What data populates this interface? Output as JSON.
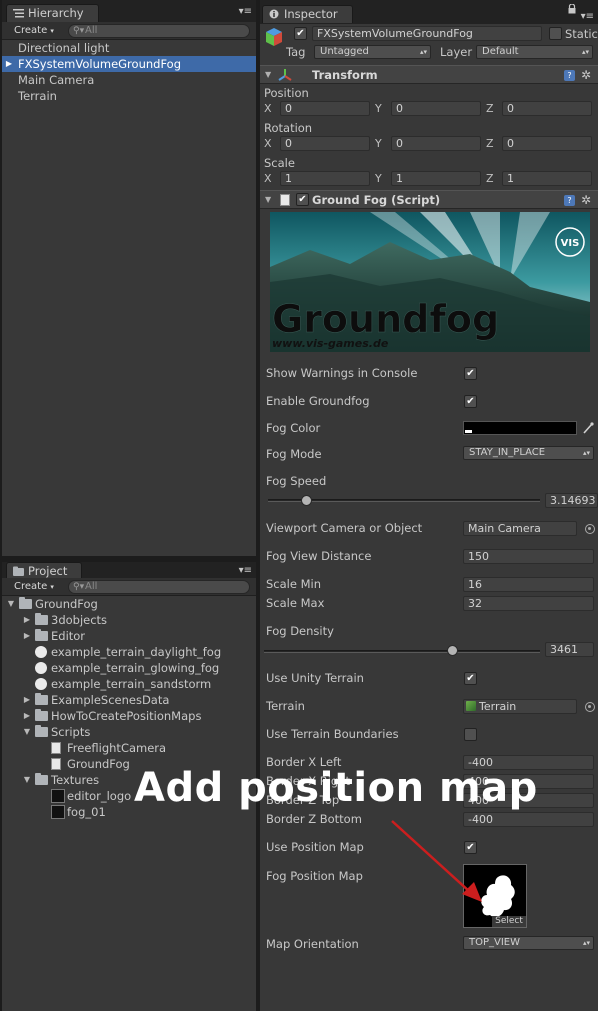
{
  "hierarchy": {
    "tab_label": "Hierarchy",
    "create_label": "Create",
    "search_placeholder": "All",
    "items": [
      {
        "label": "Directional light",
        "selected": false
      },
      {
        "label": "FXSystemVolumeGroundFog",
        "selected": true
      },
      {
        "label": "Main Camera",
        "selected": false
      },
      {
        "label": "Terrain",
        "selected": false
      }
    ]
  },
  "project": {
    "tab_label": "Project",
    "create_label": "Create",
    "search_placeholder": "All",
    "items": [
      {
        "label": "GroundFog",
        "icon": "folder-icon",
        "arrow": "expanded",
        "indent": 0
      },
      {
        "label": "3dobjects",
        "icon": "folder-icon",
        "arrow": "collapsed",
        "indent": 1
      },
      {
        "label": "Editor",
        "icon": "folder-icon",
        "arrow": "collapsed",
        "indent": 1
      },
      {
        "label": "example_terrain_daylight_fog",
        "icon": "unity-scene-icon",
        "arrow": "none",
        "indent": 1
      },
      {
        "label": "example_terrain_glowing_fog",
        "icon": "unity-scene-icon",
        "arrow": "none",
        "indent": 1
      },
      {
        "label": "example_terrain_sandstorm",
        "icon": "unity-scene-icon",
        "arrow": "none",
        "indent": 1
      },
      {
        "label": "ExampleScenesData",
        "icon": "folder-icon",
        "arrow": "collapsed",
        "indent": 1
      },
      {
        "label": "HowToCreatePositionMaps",
        "icon": "folder-icon",
        "arrow": "collapsed",
        "indent": 1
      },
      {
        "label": "Scripts",
        "icon": "folder-icon",
        "arrow": "expanded",
        "indent": 1
      },
      {
        "label": "FreeflightCamera",
        "icon": "script-file-icon",
        "arrow": "none",
        "indent": 2
      },
      {
        "label": "GroundFog",
        "icon": "script-file-icon",
        "arrow": "none",
        "indent": 2
      },
      {
        "label": "Textures",
        "icon": "folder-icon",
        "arrow": "expanded",
        "indent": 1
      },
      {
        "label": "editor_logo",
        "icon": "texture-icon",
        "arrow": "none",
        "indent": 2
      },
      {
        "label": "fog_01",
        "icon": "texture-icon",
        "arrow": "none",
        "indent": 2
      }
    ]
  },
  "inspector": {
    "tab_label": "Inspector",
    "object_name": "FXSystemVolumeGroundFog",
    "static_label": "Static",
    "tag_label": "Tag",
    "tag_value": "Untagged",
    "layer_label": "Layer",
    "layer_value": "Default",
    "transform": {
      "title": "Transform",
      "position_label": "Position",
      "rotation_label": "Rotation",
      "scale_label": "Scale",
      "x": "X",
      "y": "Y",
      "z": "Z",
      "position": [
        "0",
        "0",
        "0"
      ],
      "rotation": [
        "0",
        "0",
        "0"
      ],
      "scale": [
        "1",
        "1",
        "1"
      ]
    },
    "script": {
      "title": "Ground Fog (Script)",
      "banner_title": "Groundfog",
      "banner_url": "www.vis-games.de",
      "banner_logo": "VIS",
      "show_warnings_label": "Show Warnings in Console",
      "show_warnings": true,
      "enable_label": "Enable Groundfog",
      "enable": true,
      "fog_color_label": "Fog Color",
      "fog_color": "#000000",
      "fog_mode_label": "Fog Mode",
      "fog_mode": "STAY_IN_PLACE",
      "fog_speed_label": "Fog Speed",
      "fog_speed_value": "3.14693",
      "fog_speed_fraction": 0.14,
      "viewport_label": "Viewport Camera or Object",
      "viewport_value": "Main Camera",
      "view_distance_label": "Fog View Distance",
      "view_distance": "150",
      "scale_min_label": "Scale Min",
      "scale_min": "16",
      "scale_max_label": "Scale Max",
      "scale_max": "32",
      "density_label": "Fog Density",
      "density_value": "3461",
      "density_fraction": 0.68,
      "use_terrain_label": "Use Unity Terrain",
      "use_terrain": true,
      "terrain_label": "Terrain",
      "terrain_value": "Terrain",
      "use_boundaries_label": "Use Terrain Boundaries",
      "use_boundaries": false,
      "border_x_left_label": "Border X Left",
      "border_x_left": "-400",
      "border_x_right_label": "Border X Right",
      "border_x_right": "400",
      "border_z_top_label": "Border Z Top",
      "border_z_top": "400",
      "border_z_bottom_label": "Border Z Bottom",
      "border_z_bottom": "-400",
      "use_position_map_label": "Use Position Map",
      "use_position_map": true,
      "position_map_label": "Fog Position Map",
      "select_label": "Select",
      "orientation_label": "Map Orientation",
      "orientation_value": "TOP_VIEW"
    }
  },
  "annotation": {
    "text": "Add position map",
    "arrow_color": "#cc1e1e"
  },
  "colors": {
    "selection": "#3e6aa8",
    "panel_bg": "#383838"
  }
}
